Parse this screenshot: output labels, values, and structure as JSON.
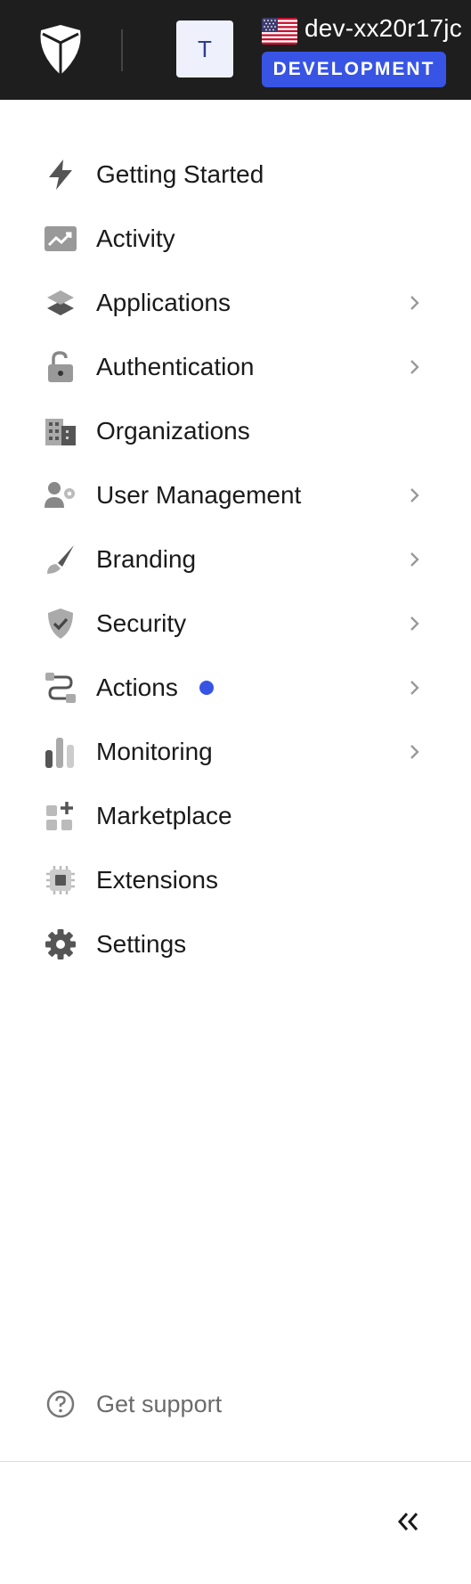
{
  "header": {
    "avatar_letter": "T",
    "tenant_name": "dev-xx20r17jc",
    "environment_badge": "DEVELOPMENT",
    "flag_icon": "us-flag-icon",
    "logo_icon": "auth0-shield-logo"
  },
  "nav": {
    "items": [
      {
        "label": "Getting Started",
        "icon": "lightning-icon",
        "has_submenu": false
      },
      {
        "label": "Activity",
        "icon": "trending-chart-icon",
        "has_submenu": false
      },
      {
        "label": "Applications",
        "icon": "layers-icon",
        "has_submenu": true
      },
      {
        "label": "Authentication",
        "icon": "unlocked-padlock-icon",
        "has_submenu": true
      },
      {
        "label": "Organizations",
        "icon": "buildings-icon",
        "has_submenu": false
      },
      {
        "label": "User Management",
        "icon": "user-gear-icon",
        "has_submenu": true
      },
      {
        "label": "Branding",
        "icon": "paintbrush-icon",
        "has_submenu": true
      },
      {
        "label": "Security",
        "icon": "shield-check-icon",
        "has_submenu": true
      },
      {
        "label": "Actions",
        "icon": "flow-icon",
        "has_submenu": true,
        "has_indicator_dot": true
      },
      {
        "label": "Monitoring",
        "icon": "bar-chart-icon",
        "has_submenu": true
      },
      {
        "label": "Marketplace",
        "icon": "add-grid-icon",
        "has_submenu": false
      },
      {
        "label": "Extensions",
        "icon": "chip-icon",
        "has_submenu": false
      },
      {
        "label": "Settings",
        "icon": "gear-icon",
        "has_submenu": false
      }
    ]
  },
  "footer": {
    "support_label": "Get support",
    "support_icon": "question-circle-icon",
    "collapse_icon": "double-chevron-left-icon"
  },
  "colors": {
    "header_bg": "#1e1e1e",
    "accent": "#3754e5",
    "icon_gray": "#6b6b6b",
    "text": "#1a1a1a"
  }
}
